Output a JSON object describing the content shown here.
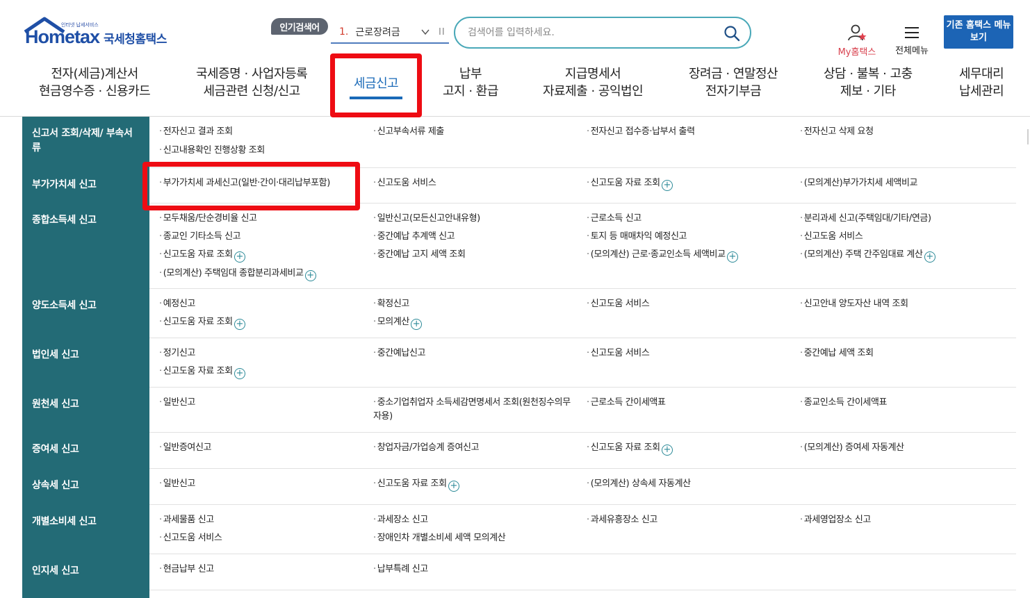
{
  "header": {
    "logo_small_text": "인터넷 납세서비스",
    "logo_text": "Hometax",
    "logo_korean": "국세청홈택스",
    "popular_label": "인기검색어",
    "popular_rank": "1.",
    "popular_keyword": "근로장려금",
    "popular_pause": "II",
    "search_placeholder": "검색어를 입력하세요.",
    "my_hometax": "My홈택스",
    "all_menu": "전체메뉴",
    "old_hometax": "기존 홈택스 메뉴 보기"
  },
  "nav": [
    {
      "line1": "전자(세금)계산서",
      "line2": "현금영수증 · 신용카드"
    },
    {
      "line1": "국세증명 · 사업자등록",
      "line2": "세금관련 신청/신고"
    },
    {
      "line1": "세금신고",
      "line2": ""
    },
    {
      "line1": "납부",
      "line2": "고지 · 환급"
    },
    {
      "line1": "지급명세서",
      "line2": "자료제출 · 공익법인"
    },
    {
      "line1": "장려금 · 연말정산",
      "line2": "전자기부금"
    },
    {
      "line1": "상담 · 불복 · 고충",
      "line2": "제보 · 기타"
    },
    {
      "line1": "세무대리",
      "line2": "납세관리"
    }
  ],
  "accent_color": "#1a6ab8",
  "category_color": "#236b76",
  "highlight_color": "#ee0c13",
  "rows": [
    {
      "category": "신고서 조회/삭제/ 부속서류",
      "items": [
        "전자신고 결과 조회",
        "신고부속서류 제출",
        "전자신고 접수증·납부서 출력",
        "전자신고 삭제 요청",
        "신고내용확인 진행상황 조회"
      ]
    },
    {
      "category": "부가가치세 신고",
      "items": [
        "부가가치세 과세신고(일반·간이·대리납부포함)",
        "신고도움 서비스",
        "신고도움 자료 조회",
        "(모의계산)부가가치세 세액비교"
      ]
    },
    {
      "category": "종합소득세 신고",
      "items": [
        "모두채움/단순경비율 신고",
        "일반신고(모든신고안내유형)",
        "근로소득 신고",
        "분리과세 신고(주택임대/기타/연금)",
        "종교인 기타소득 신고",
        "중간예납 추계액 신고",
        "토지 등 매매차익 예정신고",
        "신고도움 서비스",
        "신고도움 자료 조회",
        "중간예납 고지 세액 조회",
        "(모의계산) 근로·종교인소득 세액비교",
        "(모의계산) 주택 간주임대료 계산",
        "(모의계산) 주택임대 종합분리과세비교"
      ]
    },
    {
      "category": "양도소득세 신고",
      "items": [
        "예정신고",
        "확정신고",
        "신고도움 서비스",
        "신고안내 양도자산 내역 조회",
        "신고도움 자료 조회",
        "모의계산"
      ]
    },
    {
      "category": "법인세 신고",
      "items": [
        "정기신고",
        "중간예납신고",
        "신고도움 서비스",
        "중간예납 세액 조회",
        "신고도움 자료 조회"
      ]
    },
    {
      "category": "원천세 신고",
      "items": [
        "일반신고",
        "중소기업취업자 소득세감면명세서 조회(원천징수의무자용)",
        "근로소득 간이세액표",
        "종교인소득 간이세액표"
      ]
    },
    {
      "category": "증여세 신고",
      "items": [
        "일반증여신고",
        "창업자금/가업승계 증여신고",
        "신고도움 자료 조회",
        "(모의계산) 증여세 자동계산"
      ]
    },
    {
      "category": "상속세 신고",
      "items": [
        "일반신고",
        "신고도움 자료 조회",
        "(모의계산) 상속세 자동계산"
      ]
    },
    {
      "category": "개별소비세 신고",
      "items": [
        "과세물품 신고",
        "과세장소 신고",
        "과세유흥장소 신고",
        "과세영업장소 신고",
        "신고도움 서비스",
        "장애인차 개별소비세 세액 모의계산"
      ]
    },
    {
      "category": "인지세 신고",
      "items": [
        "현금납부 신고",
        "납부특례 신고"
      ]
    }
  ]
}
